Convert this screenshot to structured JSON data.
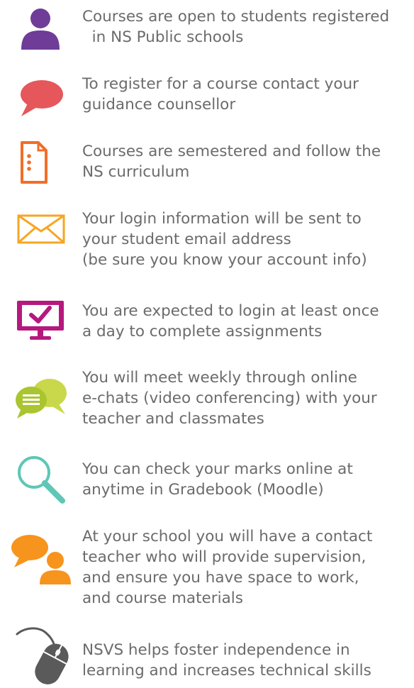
{
  "items": [
    {
      "icon": "student-icon",
      "color": "#6f3c98",
      "text": "Courses are open to students registered\n  in NS Public schools"
    },
    {
      "icon": "speech-bubble-icon",
      "color": "#e5575a",
      "text": "To register for a course contact your\nguidance counsellor"
    },
    {
      "icon": "document-icon",
      "color": "#f26e26",
      "text": "Courses are semestered and follow the\nNS curriculum"
    },
    {
      "icon": "envelope-icon",
      "color": "#f6a623",
      "text": "Your login information will be sent to\nyour student email address\n(be sure you know your account info)"
    },
    {
      "icon": "monitor-check-icon",
      "color": "#b5197e",
      "text": "You are expected to login at least once\na day to complete assignments"
    },
    {
      "icon": "chat-bubbles-icon",
      "color": "#a9c52f",
      "text": "You will meet weekly through online\ne-chats (video conferencing) with your\nteacher and classmates"
    },
    {
      "icon": "magnifier-icon",
      "color": "#5ec7b5",
      "text": "You can check your marks online at\nanytime in Gradebook (Moodle)"
    },
    {
      "icon": "contact-teacher-icon",
      "color": "#f7941d",
      "text": "At your school you will have a contact\nteacher who will provide supervision,\nand ensure you have space to work,\nand course materials"
    },
    {
      "icon": "mouse-icon",
      "color": "#5a5a5a",
      "text": "NSVS helps foster independence in\nlearning and increases technical skills"
    }
  ]
}
